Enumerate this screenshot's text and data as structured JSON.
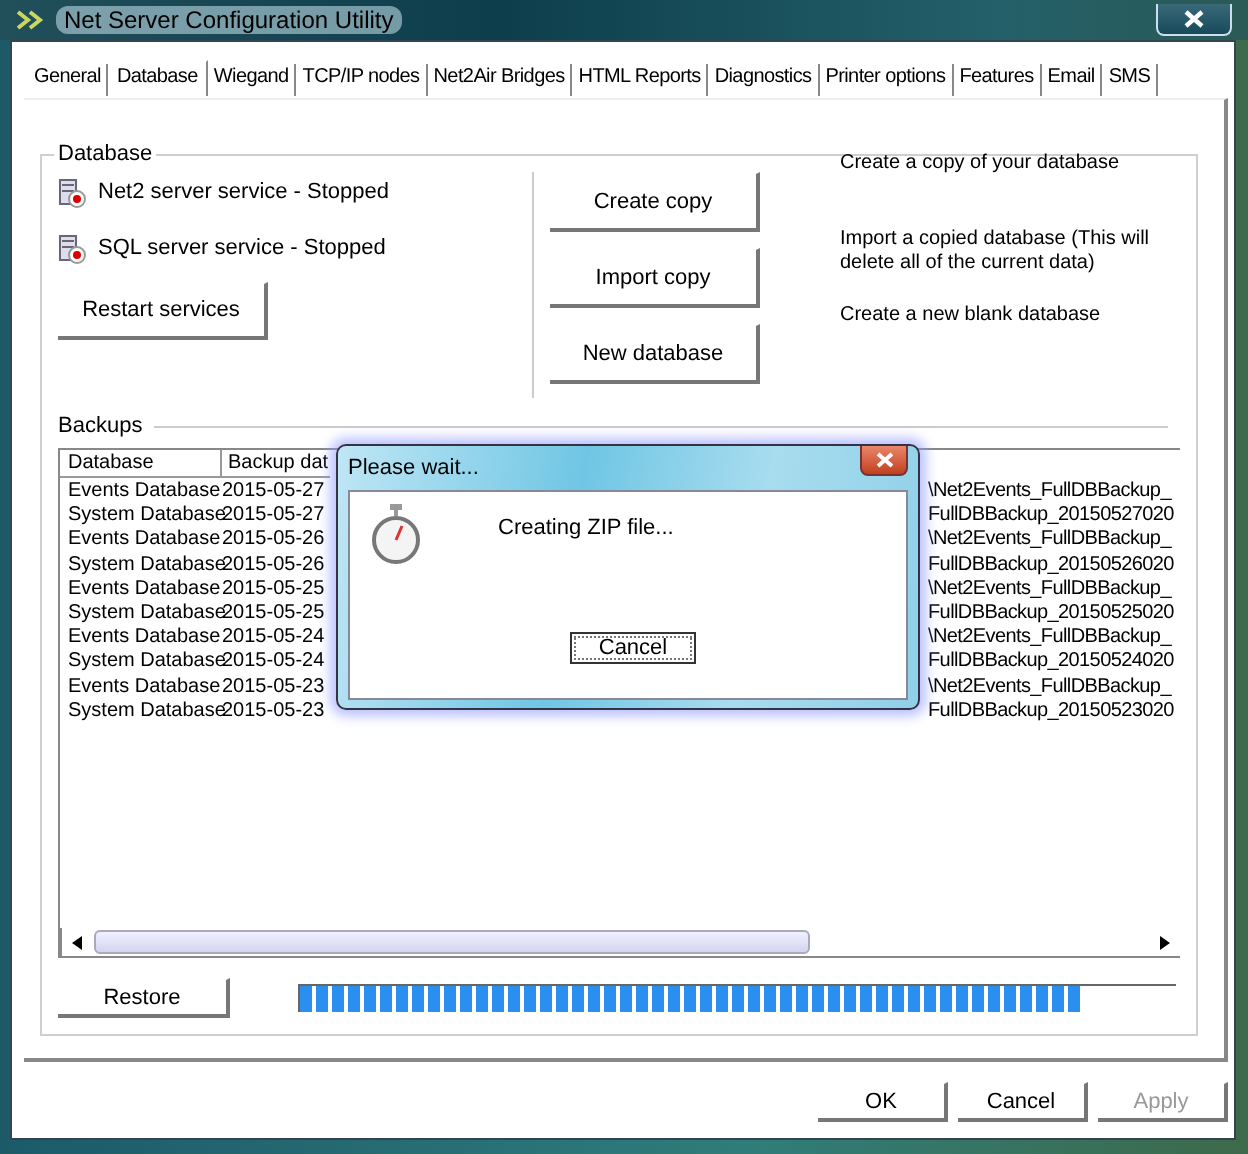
{
  "window": {
    "title": "Net Server Configuration Utility"
  },
  "tabs": [
    {
      "label": "General",
      "selected": false
    },
    {
      "label": "Database",
      "selected": true
    },
    {
      "label": "Wiegand",
      "selected": false
    },
    {
      "label": "TCP/IP nodes",
      "selected": false
    },
    {
      "label": "Net2Air Bridges",
      "selected": false
    },
    {
      "label": "HTML Reports",
      "selected": false
    },
    {
      "label": "Diagnostics",
      "selected": false
    },
    {
      "label": "Printer options",
      "selected": false
    },
    {
      "label": "Features",
      "selected": false
    },
    {
      "label": "Email",
      "selected": false
    },
    {
      "label": "SMS",
      "selected": false
    }
  ],
  "database": {
    "title": "Database",
    "services": [
      {
        "label": "Net2 server service - Stopped"
      },
      {
        "label": "SQL server service - Stopped"
      }
    ],
    "restart_button": "Restart services",
    "actions": [
      {
        "button": "Create copy",
        "description": "Create a copy of your database"
      },
      {
        "button": "Import copy",
        "description": "Import a copied database (This will delete all of the current data)"
      },
      {
        "button": "New database",
        "description": "Create a new blank database"
      }
    ]
  },
  "backups": {
    "title": "Backups",
    "columns": [
      "Database",
      "Backup dat"
    ],
    "rows": [
      {
        "database": "Events Database",
        "date": "2015-05-27",
        "column_3": "\\Net2Events_FullDBBackup_"
      },
      {
        "database": "System Database",
        "date": "2015-05-27",
        "column_3": "FullDBBackup_20150527020"
      },
      {
        "database": "Events Database",
        "date": "2015-05-26",
        "column_3": "\\Net2Events_FullDBBackup_"
      },
      {
        "database": "System Database",
        "date": "2015-05-26",
        "column_3": "FullDBBackup_20150526020"
      },
      {
        "database": "Events Database",
        "date": "2015-05-25",
        "column_3": "\\Net2Events_FullDBBackup_"
      },
      {
        "database": "System Database",
        "date": "2015-05-25",
        "column_3": "FullDBBackup_20150525020"
      },
      {
        "database": "Events Database",
        "date": "2015-05-24",
        "column_3": "\\Net2Events_FullDBBackup_"
      },
      {
        "database": "System Database",
        "date": "2015-05-24",
        "column_3": "FullDBBackup_20150524020"
      },
      {
        "database": "Events Database",
        "date": "2015-05-23",
        "column_3": "\\Net2Events_FullDBBackup_"
      },
      {
        "database": "System Database",
        "date": "2015-05-23",
        "column_3": "FullDBBackup_20150523020"
      }
    ],
    "restore_button": "Restore",
    "progress": {
      "level": 0.89
    }
  },
  "dialog": {
    "title": "Please wait...",
    "message": "Creating ZIP file...",
    "cancel_button": "Cancel"
  },
  "buttons": [
    {
      "label": "OK",
      "disabled": false
    },
    {
      "label": "Cancel",
      "disabled": false
    },
    {
      "label": "Apply",
      "disabled": true
    }
  ]
}
